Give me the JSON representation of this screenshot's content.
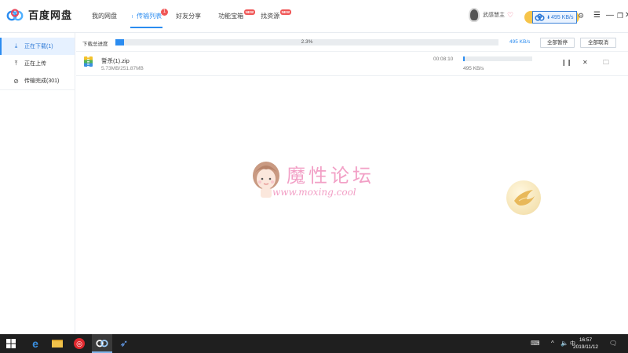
{
  "app": {
    "name": "百度网盘"
  },
  "nav": {
    "items": [
      {
        "label": "我的网盘"
      },
      {
        "label": "传输列表",
        "badge": "1",
        "active": true
      },
      {
        "label": "好友分享"
      },
      {
        "label": "功能宝箱",
        "badge": "NEW"
      },
      {
        "label": "找资源",
        "badge": "NEW"
      }
    ]
  },
  "user": {
    "name": "武感慧主",
    "speed": "495 KB/s"
  },
  "sidebar": {
    "items": [
      {
        "label": "正在下载(1)",
        "icon": "download-icon",
        "active": true
      },
      {
        "label": "正在上传",
        "icon": "upload-icon"
      },
      {
        "label": "传输完成(301)",
        "icon": "check-circle-icon"
      }
    ]
  },
  "summary": {
    "label": "下载总进度",
    "percent_text": "2.3%",
    "percent": 2.3,
    "speed": "495 KB/s",
    "pause_all": "全部暂停",
    "cancel_all": "全部取消"
  },
  "tasks": [
    {
      "name": "誓杀(1).zip",
      "size": "5.73MB/251.87MB",
      "time": "00:08:10",
      "speed": "495 KB/s",
      "progress": 2.3
    }
  ],
  "watermark": {
    "title": "魔性论坛",
    "url": "www.moxing.cool"
  },
  "taskbar": {
    "time": "16:57",
    "date": "2019/11/12"
  },
  "colors": {
    "accent": "#2b8cf0",
    "badge": "#f05656",
    "watermark": "#f2a0c6"
  }
}
